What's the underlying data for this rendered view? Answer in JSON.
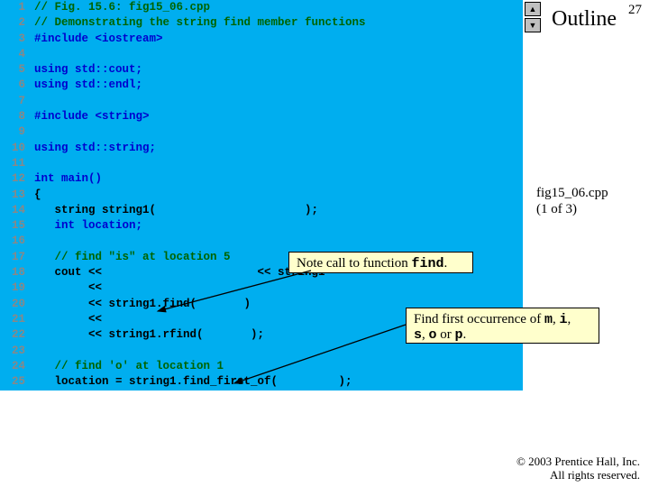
{
  "page_number": "27",
  "header": {
    "outline": "Outline"
  },
  "file_info": {
    "name": "fig15_06.cpp",
    "part": "(1 of 3)"
  },
  "copyright": {
    "line1": "© 2003 Prentice Hall, Inc.",
    "line2": "All rights reserved."
  },
  "callouts": {
    "note_find": {
      "prefix": "Note call to function ",
      "fn": "find",
      "suffix": "."
    },
    "first_occ": {
      "prefix": "Find first occurrence of ",
      "m": "m",
      "c1": ", ",
      "i": "i",
      "c2": ",",
      "s": "s",
      "c3": ", ",
      "o": "o",
      "c4": " or ",
      "p": "p",
      "end": "."
    }
  },
  "code_lines": [
    {
      "n": "1",
      "cls": "cm",
      "t": "// Fig. 15.6: fig15_06.cpp"
    },
    {
      "n": "2",
      "cls": "cm",
      "t": "// Demonstrating the string find member functions"
    },
    {
      "n": "3",
      "cls": "bl",
      "t": "#include <iostream>"
    },
    {
      "n": "4",
      "cls": "",
      "t": ""
    },
    {
      "n": "5",
      "cls": "bl",
      "t": "using std::cout;"
    },
    {
      "n": "6",
      "cls": "bl",
      "t": "using std::endl;"
    },
    {
      "n": "7",
      "cls": "",
      "t": ""
    },
    {
      "n": "8",
      "cls": "bl",
      "t": "#include <string>"
    },
    {
      "n": "9",
      "cls": "",
      "t": ""
    },
    {
      "n": "10",
      "cls": "bl",
      "t": "using std::string;"
    },
    {
      "n": "11",
      "cls": "",
      "t": ""
    },
    {
      "n": "12",
      "cls": "bl",
      "t": "int main()"
    },
    {
      "n": "13",
      "cls": "",
      "t": "{"
    },
    {
      "n": "14",
      "cls": "",
      "t": "   string string1(                      );"
    },
    {
      "n": "15",
      "cls": "bl",
      "t": "   int location;"
    },
    {
      "n": "16",
      "cls": "",
      "t": ""
    },
    {
      "n": "17",
      "cls": "cm",
      "t": "   // find \"is\" at location 5"
    },
    {
      "n": "18",
      "cls": "",
      "t": "   cout <<                       << string1"
    },
    {
      "n": "19",
      "cls": "",
      "t": "        << "
    },
    {
      "n": "20",
      "cls": "",
      "t": "        << string1.find(       )"
    },
    {
      "n": "21",
      "cls": "",
      "t": "        << "
    },
    {
      "n": "22",
      "cls": "",
      "t": "        << string1.rfind(       );"
    },
    {
      "n": "23",
      "cls": "",
      "t": ""
    },
    {
      "n": "24",
      "cls": "cm",
      "t": "   // find 'o' at location 1"
    },
    {
      "n": "25",
      "cls": "",
      "t": "   location = string1.find_first_of(         );"
    }
  ]
}
